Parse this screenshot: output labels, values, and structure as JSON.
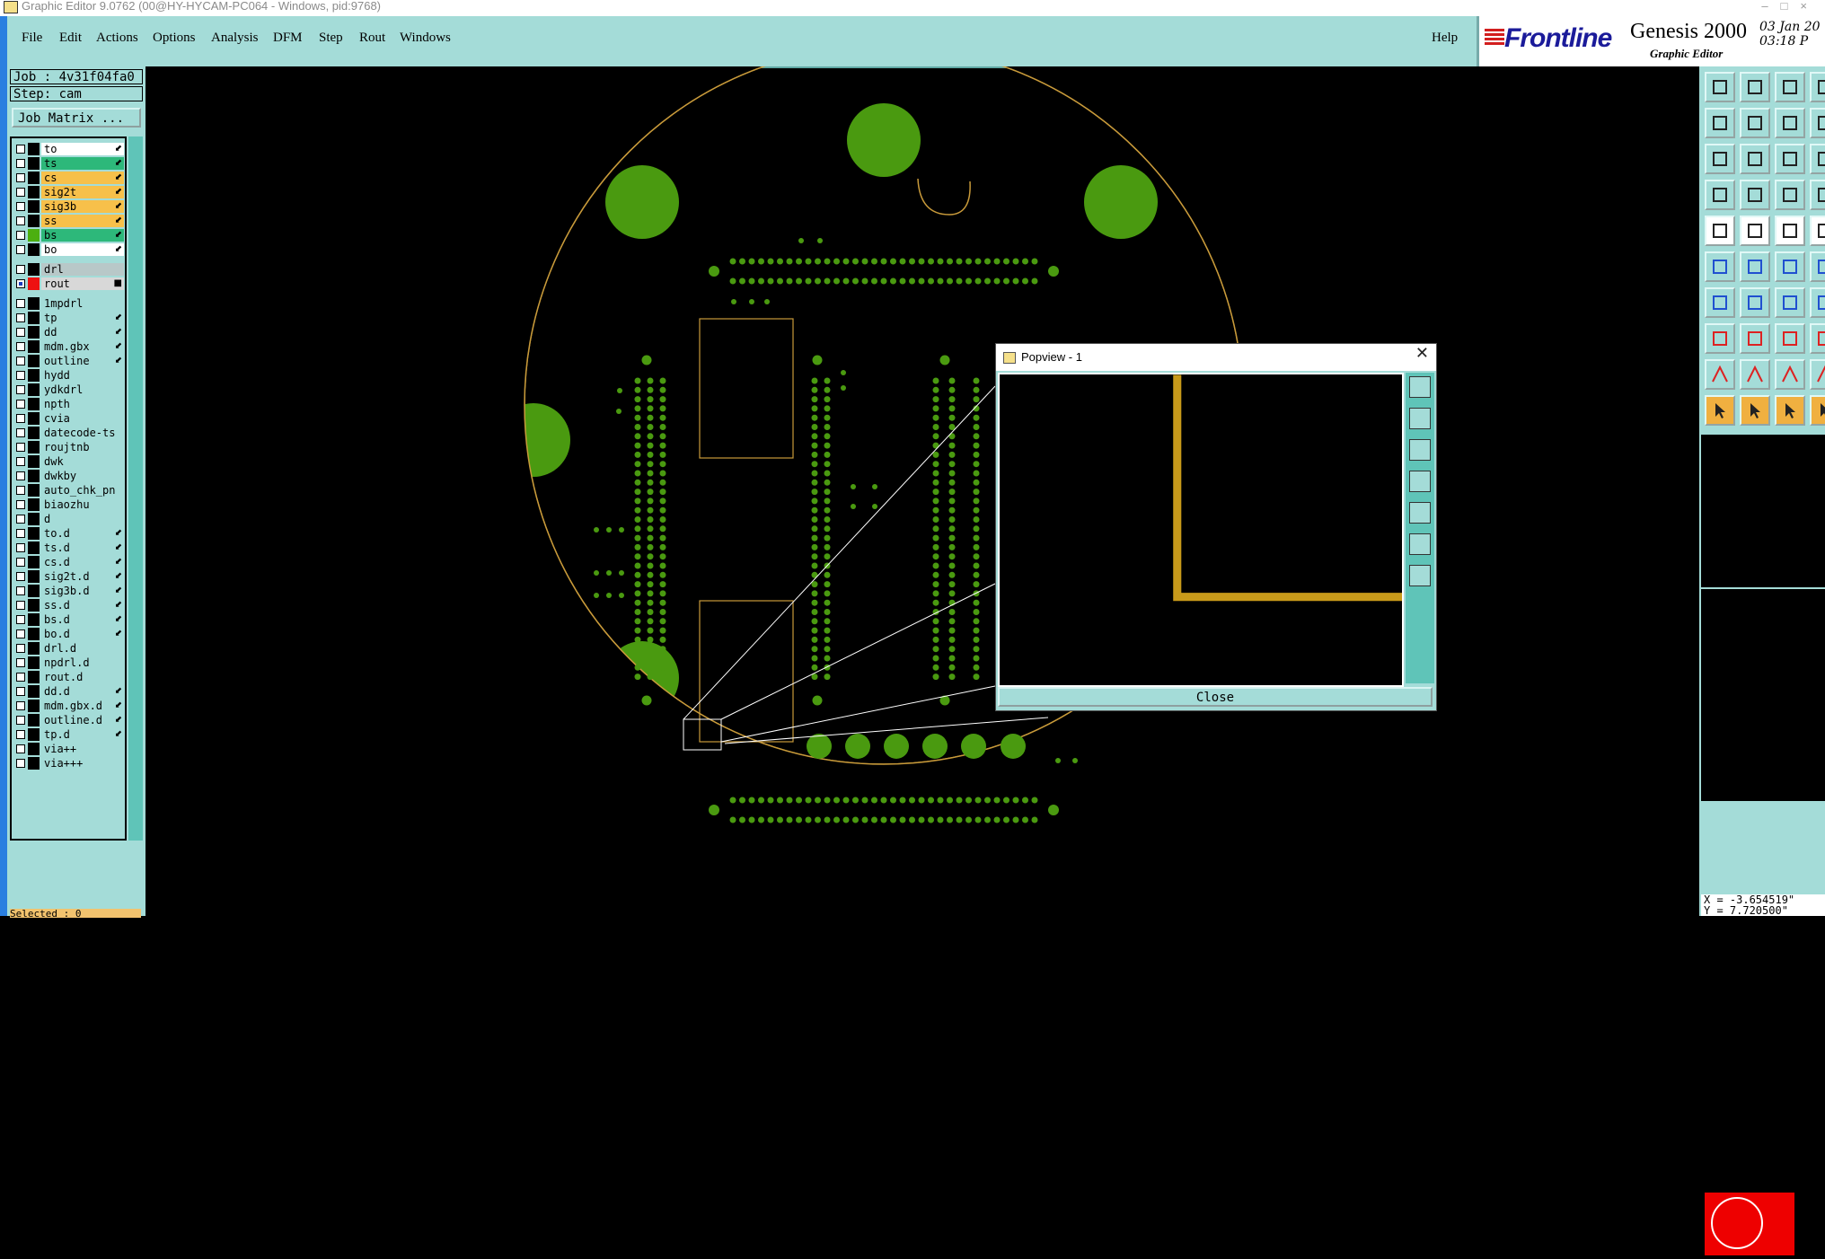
{
  "window": {
    "title": "Graphic Editor 9.0762 (00@HY-HYCAM-PC064 - Windows, pid:9768)"
  },
  "menu": {
    "items": [
      "File",
      "Edit",
      "Actions",
      "Options",
      "Analysis",
      "DFM",
      "Step",
      "Rout",
      "Windows"
    ],
    "help": "Help"
  },
  "branding": {
    "logo": "Frontline",
    "product": "Genesis 2000",
    "subtitle": "Graphic Editor",
    "date": "03 Jan 20",
    "time": "03:18 P"
  },
  "job": {
    "job_label": "Job : 4v31f04fa0",
    "step_label": "Step: cam",
    "matrix_button": "Job Matrix ..."
  },
  "layers": [
    {
      "name": "to",
      "bg": "#ffffff",
      "swatch": "#000000",
      "mark": "⬋"
    },
    {
      "name": "ts",
      "bg": "#2db87a",
      "swatch": "#000000",
      "mark": "⬋"
    },
    {
      "name": "cs",
      "bg": "#f7c04a",
      "swatch": "#000000",
      "mark": "⬋"
    },
    {
      "name": "sig2t",
      "bg": "#f7c04a",
      "swatch": "#000000",
      "mark": "⬋"
    },
    {
      "name": "sig3b",
      "bg": "#f7c04a",
      "swatch": "#000000",
      "mark": "⬋"
    },
    {
      "name": "ss",
      "bg": "#f7c04a",
      "swatch": "#000000",
      "mark": "⬋"
    },
    {
      "name": "bs",
      "bg": "#2db87a",
      "swatch": "#4caf10",
      "mark": "⬋"
    },
    {
      "name": "bo",
      "bg": "#ffffff",
      "swatch": "#000000",
      "mark": "⬋"
    },
    {
      "name": "drl",
      "bg": "#b8c8c8",
      "swatch": "#000000",
      "mark": ""
    },
    {
      "name": "rout",
      "bg": "#d8d8d8",
      "swatch": "#ee1111",
      "mark": "■",
      "checked": true
    },
    {
      "name": "1mpdrl",
      "bg": "#a4dcd8",
      "swatch": "#000000",
      "mark": ""
    },
    {
      "name": "tp",
      "bg": "#a4dcd8",
      "swatch": "#000000",
      "mark": "⬋"
    },
    {
      "name": "dd",
      "bg": "#a4dcd8",
      "swatch": "#000000",
      "mark": "⬋"
    },
    {
      "name": "mdm.gbx",
      "bg": "#a4dcd8",
      "swatch": "#000000",
      "mark": "⬋"
    },
    {
      "name": "outline",
      "bg": "#a4dcd8",
      "swatch": "#000000",
      "mark": "⬋"
    },
    {
      "name": "hydd",
      "bg": "#a4dcd8",
      "swatch": "#000000",
      "mark": ""
    },
    {
      "name": "ydkdrl",
      "bg": "#a4dcd8",
      "swatch": "#000000",
      "mark": ""
    },
    {
      "name": "npth",
      "bg": "#a4dcd8",
      "swatch": "#000000",
      "mark": ""
    },
    {
      "name": "cvia",
      "bg": "#a4dcd8",
      "swatch": "#000000",
      "mark": ""
    },
    {
      "name": "datecode-ts",
      "bg": "#a4dcd8",
      "swatch": "#000000",
      "mark": ""
    },
    {
      "name": "roujtnb",
      "bg": "#a4dcd8",
      "swatch": "#000000",
      "mark": ""
    },
    {
      "name": "dwk",
      "bg": "#a4dcd8",
      "swatch": "#000000",
      "mark": ""
    },
    {
      "name": "dwkby",
      "bg": "#a4dcd8",
      "swatch": "#000000",
      "mark": ""
    },
    {
      "name": "auto_chk_pn",
      "bg": "#a4dcd8",
      "swatch": "#000000",
      "mark": ""
    },
    {
      "name": "biaozhu",
      "bg": "#a4dcd8",
      "swatch": "#000000",
      "mark": ""
    },
    {
      "name": "d",
      "bg": "#a4dcd8",
      "swatch": "#000000",
      "mark": ""
    },
    {
      "name": "to.d",
      "bg": "#a4dcd8",
      "swatch": "#000000",
      "mark": "⬋"
    },
    {
      "name": "ts.d",
      "bg": "#a4dcd8",
      "swatch": "#000000",
      "mark": "⬋"
    },
    {
      "name": "cs.d",
      "bg": "#a4dcd8",
      "swatch": "#000000",
      "mark": "⬋"
    },
    {
      "name": "sig2t.d",
      "bg": "#a4dcd8",
      "swatch": "#000000",
      "mark": "⬋"
    },
    {
      "name": "sig3b.d",
      "bg": "#a4dcd8",
      "swatch": "#000000",
      "mark": "⬋"
    },
    {
      "name": "ss.d",
      "bg": "#a4dcd8",
      "swatch": "#000000",
      "mark": "⬋"
    },
    {
      "name": "bs.d",
      "bg": "#a4dcd8",
      "swatch": "#000000",
      "mark": "⬋"
    },
    {
      "name": "bo.d",
      "bg": "#a4dcd8",
      "swatch": "#000000",
      "mark": "⬋"
    },
    {
      "name": "drl.d",
      "bg": "#a4dcd8",
      "swatch": "#000000",
      "mark": ""
    },
    {
      "name": "npdrl.d",
      "bg": "#a4dcd8",
      "swatch": "#000000",
      "mark": ""
    },
    {
      "name": "rout.d",
      "bg": "#a4dcd8",
      "swatch": "#000000",
      "mark": ""
    },
    {
      "name": "dd.d",
      "bg": "#a4dcd8",
      "swatch": "#000000",
      "mark": "⬋"
    },
    {
      "name": "mdm.gbx.d",
      "bg": "#a4dcd8",
      "swatch": "#000000",
      "mark": "⬋"
    },
    {
      "name": "outline.d",
      "bg": "#a4dcd8",
      "swatch": "#000000",
      "mark": "⬋"
    },
    {
      "name": "tp.d",
      "bg": "#a4dcd8",
      "swatch": "#000000",
      "mark": "⬋"
    },
    {
      "name": "via++",
      "bg": "#a4dcd8",
      "swatch": "#000000",
      "mark": ""
    },
    {
      "name": "via+++",
      "bg": "#a4dcd8",
      "swatch": "#000000",
      "mark": ""
    }
  ],
  "status": {
    "selected": "Selected : 0"
  },
  "popview": {
    "title": "Popview - 1",
    "close_label": "Close"
  },
  "coords": {
    "x": "X = -3.654519\"",
    "y": "Y = 7.720500\""
  },
  "colors": {
    "panel": "#a4dcd8",
    "pad_green": "#4a9a10",
    "outline_orange": "#c89a3a",
    "trace_gold": "#c89a1a"
  }
}
